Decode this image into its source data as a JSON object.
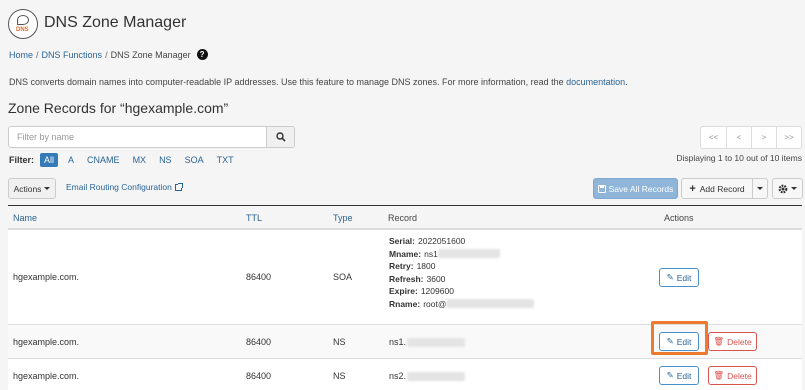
{
  "app": {
    "title": "DNS Zone Manager",
    "logo_text": "DNS"
  },
  "breadcrumb": {
    "home": "Home",
    "functions": "DNS Functions",
    "current": "DNS Zone Manager",
    "separator": "/"
  },
  "description": {
    "text": "DNS converts domain names into computer-readable IP addresses. Use this feature to manage DNS zones. For more information, read the",
    "link": "documentation",
    "end": "."
  },
  "zone_title": "Zone Records for “hgexample.com”",
  "search": {
    "placeholder": "Filter by name",
    "value": ""
  },
  "filter": {
    "label": "Filter:",
    "options": [
      "All",
      "A",
      "CNAME",
      "MX",
      "NS",
      "SOA",
      "TXT"
    ],
    "active": "All"
  },
  "pagination": {
    "buttons": [
      "<<",
      "<",
      ">",
      ">>"
    ],
    "displaying": "Displaying 1 to 10 out of 10 items"
  },
  "toolbar": {
    "actions_label": "Actions",
    "email_routing": "Email Routing Configuration",
    "save_all": "Save All Records",
    "add_record": "Add Record"
  },
  "table": {
    "headers": {
      "name": "Name",
      "ttl": "TTL",
      "type": "Type",
      "record": "Record",
      "actions": "Actions"
    },
    "rows": [
      {
        "name": "hgexample.com.",
        "ttl": "86400",
        "type": "SOA",
        "soa": {
          "serial_label": "Serial:",
          "serial": "2022051600",
          "mname_label": "Mname:",
          "mname": "ns1",
          "retry_label": "Retry:",
          "retry": "1800",
          "refresh_label": "Refresh:",
          "refresh": "3600",
          "expire_label": "Expire:",
          "expire": "1209600",
          "rname_label": "Rname:",
          "rname": "root@"
        },
        "edit": "Edit"
      },
      {
        "name": "hgexample.com.",
        "ttl": "86400",
        "type": "NS",
        "record": "ns1.",
        "edit": "Edit",
        "delete": "Delete"
      },
      {
        "name": "hgexample.com.",
        "ttl": "86400",
        "type": "NS",
        "record": "ns2.",
        "edit": "Edit",
        "delete": "Delete"
      }
    ]
  },
  "colors": {
    "link": "#2a6496",
    "primary": "#337ab7",
    "danger": "#d9534f",
    "highlight": "#ec7a2f"
  }
}
